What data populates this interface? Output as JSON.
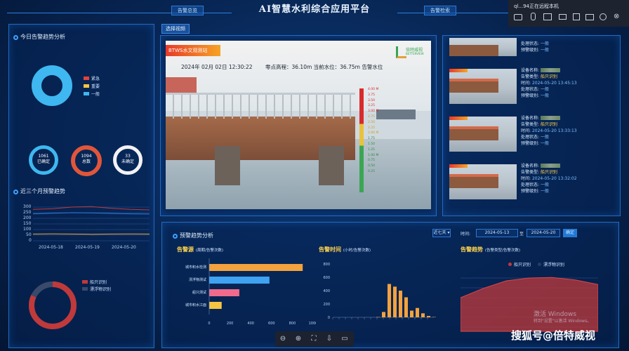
{
  "header": {
    "title": "AI智慧水利综合应用平台",
    "left_button": "告警总览",
    "right_button": "告警检索"
  },
  "notification": {
    "text": "ql...94正在远程本机"
  },
  "today_alarm": {
    "title": "今日告警趋势分析",
    "legend": [
      "紧急",
      "重要",
      "一般"
    ],
    "rings": [
      {
        "value": "1061",
        "label": "已确定"
      },
      {
        "value": "1094",
        "label": "总数"
      },
      {
        "value": "33",
        "label": "未确定"
      }
    ]
  },
  "three_month": {
    "title": "近三个月预警趋势",
    "y_ticks": [
      "300",
      "250",
      "200",
      "150",
      "100",
      "50",
      "0"
    ],
    "x_ticks": [
      "2024-05-18",
      "2024-05-19",
      "2024-05-20"
    ]
  },
  "bottom_left_legend": [
    "船只识别",
    "漂浮物识别"
  ],
  "camera": {
    "tab": "选择视频",
    "station": "BTWS水文观测站",
    "date": "2024年 02月 02日  12:30:22",
    "zero_elev": "零点高程：36.10m  当前水位：36.75m 告警水位",
    "gauge_red": [
      "4.00 M",
      "3.75",
      "3.50",
      "3.25",
      "3.00 M"
    ],
    "gauge_yellow": [
      "2.75",
      "2.50",
      "2.25",
      "2.00 M"
    ],
    "gauge_green": [
      "1.75",
      "1.50",
      "1.25",
      "1.00 M",
      "0.75",
      "0.50",
      "0.25"
    ],
    "logo_name": "倍特威视",
    "logo_sub": "BETTERVIEW"
  },
  "alarms": [
    {
      "type_label": "告警类型:",
      "type": "船只识别",
      "time_label": "时间:",
      "time": "2024-05-20 13:45:13",
      "status_label": "处理状态:",
      "status": "一般",
      "level_label": "预警级别:",
      "level": "一般",
      "name_label": "设备名称:"
    },
    {
      "type_label": "告警类型:",
      "type": "船只识别",
      "time_label": "时间:",
      "time": "2024-05-20 13:33:13",
      "status_label": "处理状态:",
      "status": "一般",
      "level_label": "预警级别:",
      "level": "一般",
      "name_label": "设备名称:"
    },
    {
      "type_label": "告警类型:",
      "type": "船只识别",
      "time_label": "时间:",
      "time": "2024-05-20 13:32:02",
      "status_label": "处理状态:",
      "status": "一般",
      "level_label": "预警级别:",
      "level": "一般",
      "name_label": "设备名称:"
    }
  ],
  "alarm_top": {
    "status_label": "处理状态:",
    "level_label": "预警级别:",
    "value": "一般"
  },
  "warn_trend": {
    "title": "预警趋势分析",
    "range": "近七天",
    "time_label": "时间:",
    "start": "2024-05-13",
    "to": "至",
    "end": "2024-05-20",
    "confirm": "确定",
    "source": {
      "title": "告警源",
      "unit": "(周期/告警次数)"
    },
    "time_chart": {
      "title": "告警时间",
      "unit": "(小时/告警次数)"
    },
    "trend_chart": {
      "title": "告警趋势",
      "unit": "(告警类型/告警次数)"
    },
    "trend_legend": [
      "船只识别",
      "漂浮物识别"
    ]
  },
  "chart_data": [
    {
      "type": "bar",
      "orientation": "horizontal",
      "categories": [
        "城市积水检测",
        "漂浮物测试",
        "船只测试",
        "城市积水江面"
      ],
      "values": [
        900,
        580,
        290,
        120
      ],
      "x_ticks": [
        "0",
        "200",
        "400",
        "600",
        "800",
        "1000"
      ],
      "xlim": [
        0,
        1000
      ],
      "colors": [
        "#f3a23d",
        "#3fa3f2",
        "#f06a8c",
        "#f5c542"
      ]
    },
    {
      "type": "bar",
      "values": [
        5,
        80,
        500,
        460,
        400,
        300,
        100,
        140,
        60,
        20,
        5
      ],
      "y_ticks": [
        "800",
        "600",
        "400",
        "200",
        "0"
      ],
      "ylim": [
        0,
        800
      ],
      "color": "#f3a23d"
    },
    {
      "type": "area",
      "series": [
        {
          "name": "船只识别",
          "values": [
            180,
            230,
            270,
            285,
            288,
            275,
            250
          ],
          "color": "#c0393b"
        }
      ]
    },
    {
      "type": "line",
      "series": [
        {
          "values": [
            280,
            285,
            300,
            305,
            290,
            280,
            275
          ],
          "color": "#c0393b"
        },
        {
          "values": [
            240,
            245,
            250,
            248,
            244,
            240,
            238
          ],
          "color": "#2e7be0"
        },
        {
          "values": [
            60,
            62,
            60,
            58,
            60,
            61,
            60
          ],
          "color": "#f3a23d"
        }
      ],
      "ylim": [
        0,
        300
      ]
    },
    {
      "type": "pie",
      "values": [
        82,
        18
      ],
      "colors": [
        "#c0393b",
        "#3a4a6a"
      ]
    }
  ],
  "watermark": {
    "brand": "搜狐号@倍特威视",
    "win_activate": "激活 Windows",
    "win_hint": "转到\"设置\"以激活 Windows。"
  }
}
